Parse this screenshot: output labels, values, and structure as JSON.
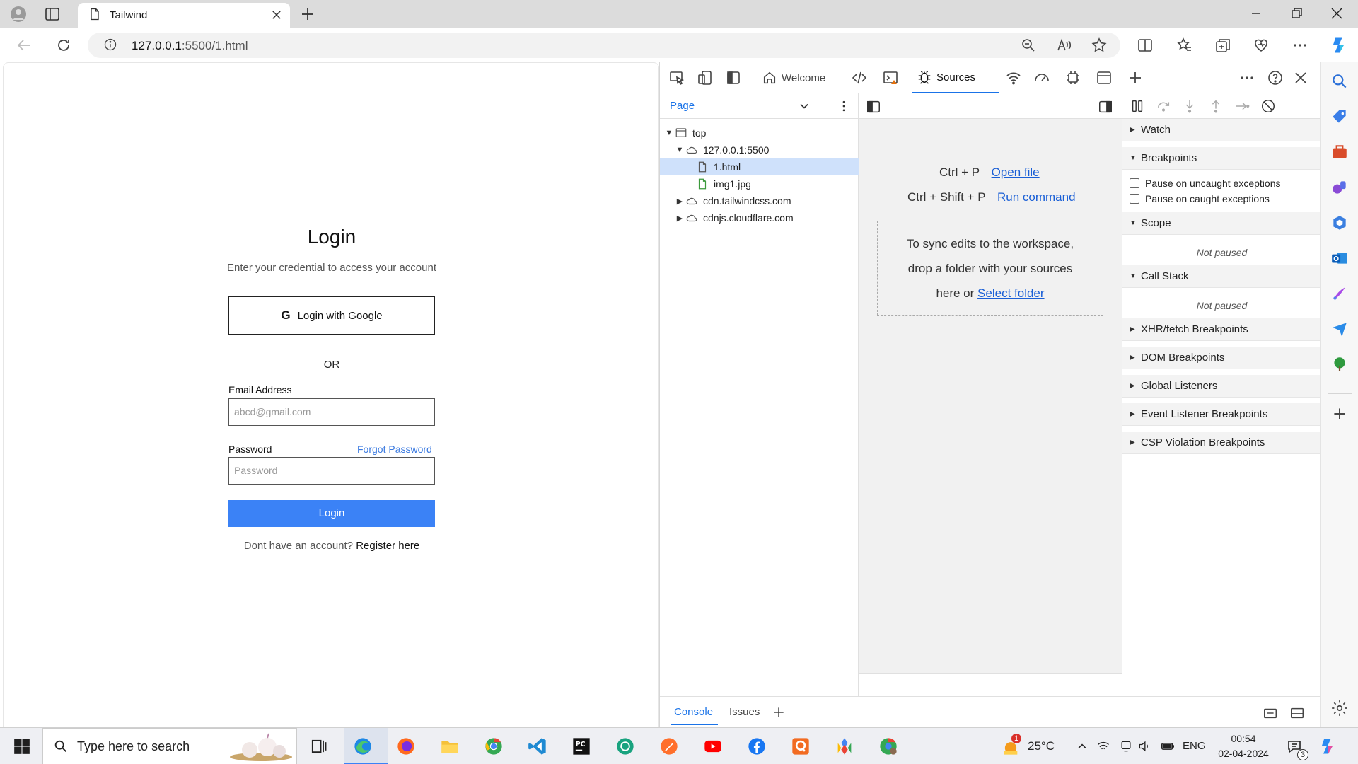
{
  "browser": {
    "tab_title": "Tailwind",
    "url_host": "127.0.0.1",
    "url_path": ":5500/1.html"
  },
  "page": {
    "title": "Login",
    "subtitle": "Enter your credential to access your account",
    "google_label": "Login with Google",
    "google_glyph": "G",
    "or_text": "OR",
    "email_label": "Email Address",
    "email_placeholder": "abcd@gmail.com",
    "password_label": "Password",
    "forgot_label": "Forgot Password",
    "password_placeholder": "Password",
    "login_button": "Login",
    "register_prompt": "Dont have an account?",
    "register_link": "Register here"
  },
  "devtools": {
    "welcome_tab": "Welcome",
    "sources_tab": "Sources",
    "navigator_tab": "Page",
    "tree": [
      {
        "label": "top",
        "indent": 0,
        "expand": "down",
        "icon": "frame-icon"
      },
      {
        "label": "127.0.0.1:5500",
        "indent": 1,
        "expand": "down",
        "icon": "cloud-icon"
      },
      {
        "label": "1.html",
        "indent": 2,
        "expand": "",
        "icon": "file-icon",
        "selected": true
      },
      {
        "label": "img1.jpg",
        "indent": 2,
        "expand": "",
        "icon": "image-file-icon"
      },
      {
        "label": "cdn.tailwindcss.com",
        "indent": 1,
        "expand": "right",
        "icon": "cloud-icon"
      },
      {
        "label": "cdnjs.cloudflare.com",
        "indent": 1,
        "expand": "right",
        "icon": "cloud-icon"
      }
    ],
    "editor": {
      "open_file_keys": "Ctrl + P",
      "open_file_link": "Open file",
      "run_command_keys": "Ctrl + Shift + P",
      "run_command_link": "Run command",
      "drop_line1": "To sync edits to the workspace,",
      "drop_line2": "drop a folder with your sources",
      "drop_line3_prefix": "here or",
      "drop_line3_link": "Select folder"
    },
    "debugger": {
      "watch": "Watch",
      "breakpoints": "Breakpoints",
      "pause_uncaught": "Pause on uncaught exceptions",
      "pause_caught": "Pause on caught exceptions",
      "scope": "Scope",
      "scope_status": "Not paused",
      "call_stack": "Call Stack",
      "call_stack_status": "Not paused",
      "xhr": "XHR/fetch Breakpoints",
      "dom": "DOM Breakpoints",
      "global": "Global Listeners",
      "event": "Event Listener Breakpoints",
      "csp": "CSP Violation Breakpoints"
    },
    "drawer": {
      "console": "Console",
      "issues": "Issues"
    }
  },
  "taskbar": {
    "search_placeholder": "Type here to search",
    "temperature": "25°C",
    "language": "ENG",
    "time": "00:54",
    "date": "02-04-2024",
    "notification_count": "3",
    "weather_badge": "1"
  },
  "colors": {
    "accent": "#1a73e8",
    "login_button": "#3b82f6",
    "link": "#3b7ae0"
  }
}
